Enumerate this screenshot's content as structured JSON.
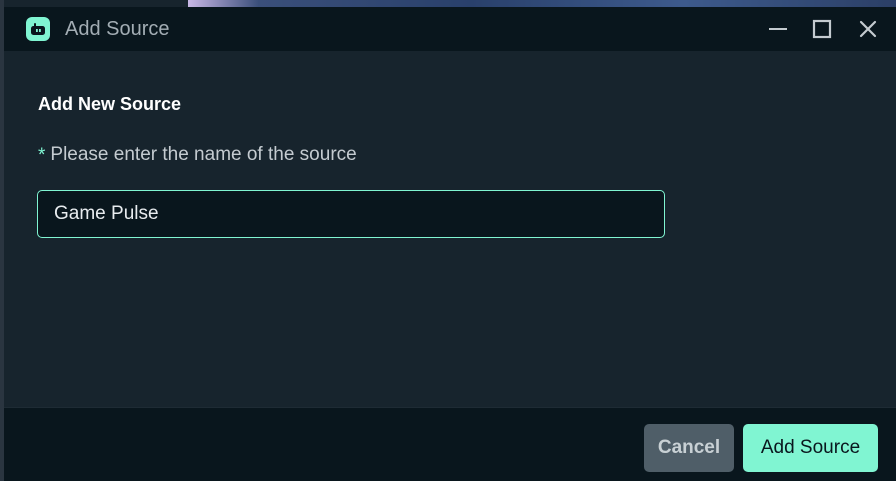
{
  "window": {
    "title": "Add Source",
    "logo_icon": "streamlabs-logo-icon",
    "controls": [
      "minimize-icon",
      "maximize-icon",
      "close-icon"
    ]
  },
  "form": {
    "heading": "Add New Source",
    "required_marker": "*",
    "name_label": "Please enter the name of the source",
    "name_value": "Game Pulse"
  },
  "footer": {
    "cancel_label": "Cancel",
    "add_label": "Add Source"
  },
  "colors": {
    "accent": "#80f5d2",
    "background": "#17242d",
    "titlebar": "#09161d",
    "cancel_bg": "#4f5e68"
  }
}
